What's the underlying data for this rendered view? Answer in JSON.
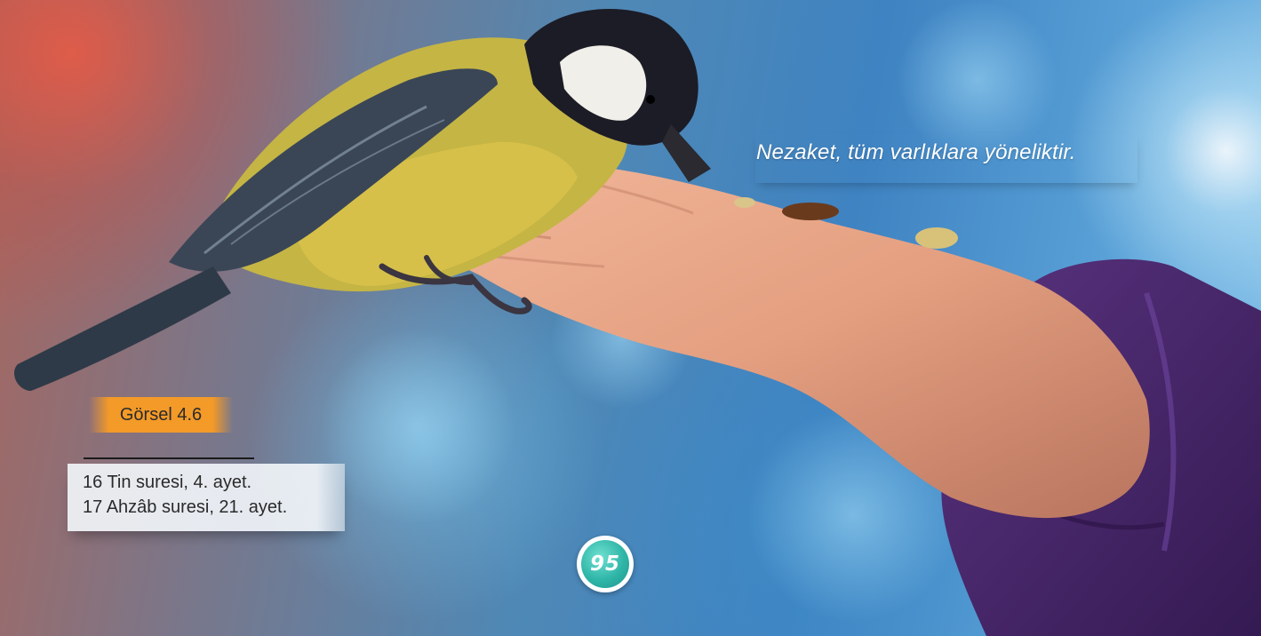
{
  "caption": "Nezaket, tüm varlıklara yöneliktir.",
  "figure_label": "Görsel 4.6",
  "footnotes": [
    "16 Tin suresi, 4. ayet.",
    "17 Ahzâb suresi, 21. ayet."
  ],
  "page_number": "95",
  "colors": {
    "accent_orange": "#f39a28",
    "page_badge_teal": "#2fb6a8",
    "sleeve_purple": "#4a2a6e"
  }
}
